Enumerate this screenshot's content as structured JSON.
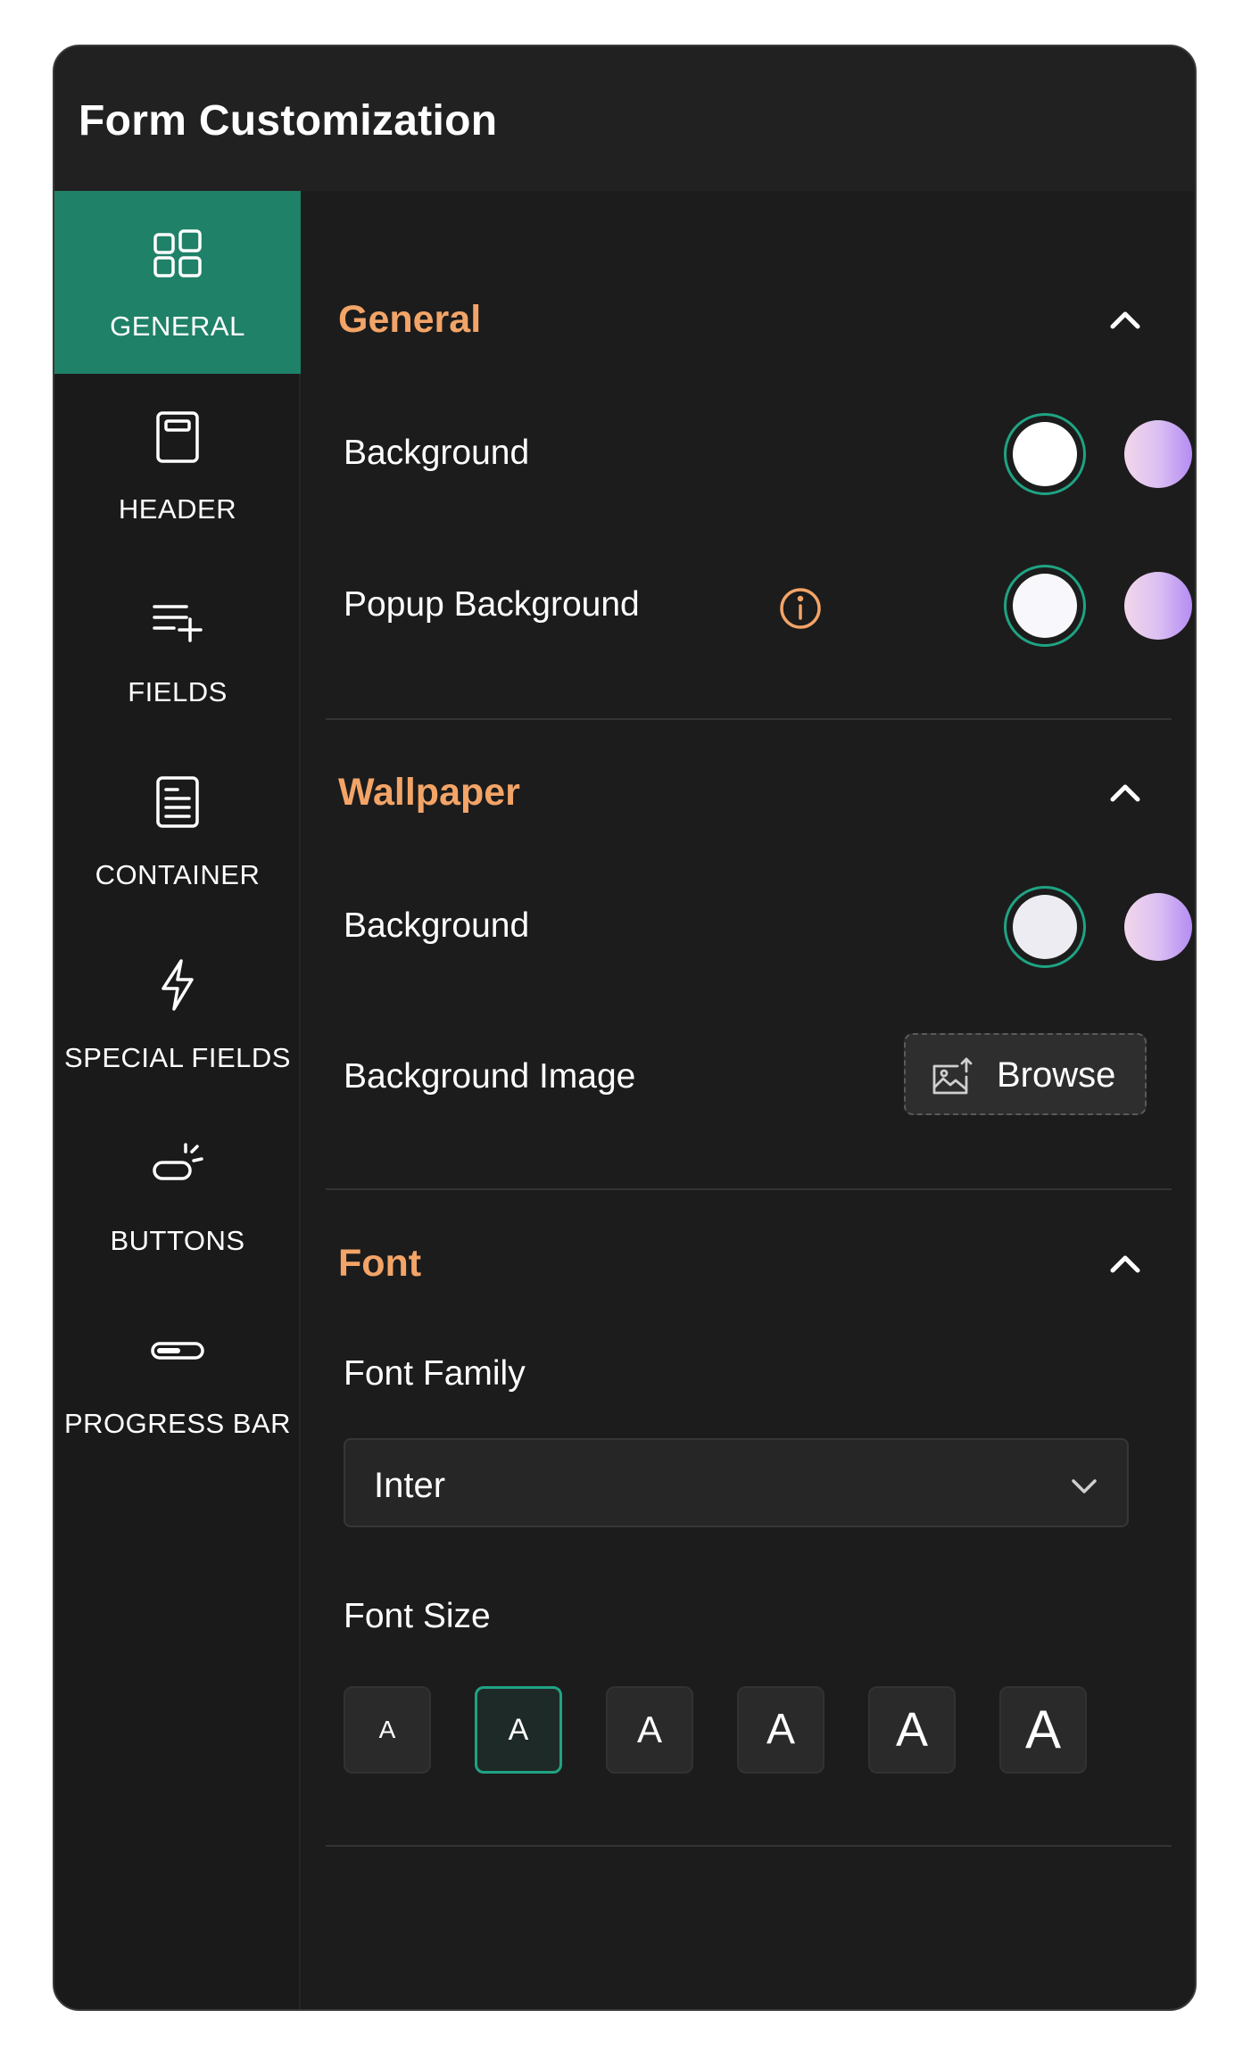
{
  "window": {
    "title": "Form Customization"
  },
  "sidebar": {
    "items": [
      {
        "label": "GENERAL",
        "icon": "grid-icon",
        "active": true
      },
      {
        "label": "HEADER",
        "icon": "header-icon",
        "active": false
      },
      {
        "label": "FIELDS",
        "icon": "add-list-icon",
        "active": false
      },
      {
        "label": "CONTAINER",
        "icon": "document-icon",
        "active": false
      },
      {
        "label": "SPECIAL FIELDS",
        "icon": "lightning-icon",
        "active": false
      },
      {
        "label": "BUTTONS",
        "icon": "button-click-icon",
        "active": false
      },
      {
        "label": "PROGRESS BAR",
        "icon": "progress-icon",
        "active": false
      }
    ]
  },
  "sections": {
    "general": {
      "title": "General",
      "background_label": "Background",
      "background_color": "#ffffff",
      "popup_label": "Popup Background",
      "popup_color": "#f8f8fc"
    },
    "wallpaper": {
      "title": "Wallpaper",
      "background_label": "Background",
      "background_color": "#ececf2",
      "image_label": "Background Image",
      "browse_label": "Browse"
    },
    "font": {
      "title": "Font",
      "family_label": "Font Family",
      "family_value": "Inter",
      "size_label": "Font Size",
      "sizes": [
        "A",
        "A",
        "A",
        "A",
        "A",
        "A"
      ],
      "selected_size_index": 1
    }
  },
  "colors": {
    "accent": "#1f8168",
    "accent_border": "#1fa383",
    "section_title": "#f3a467"
  }
}
